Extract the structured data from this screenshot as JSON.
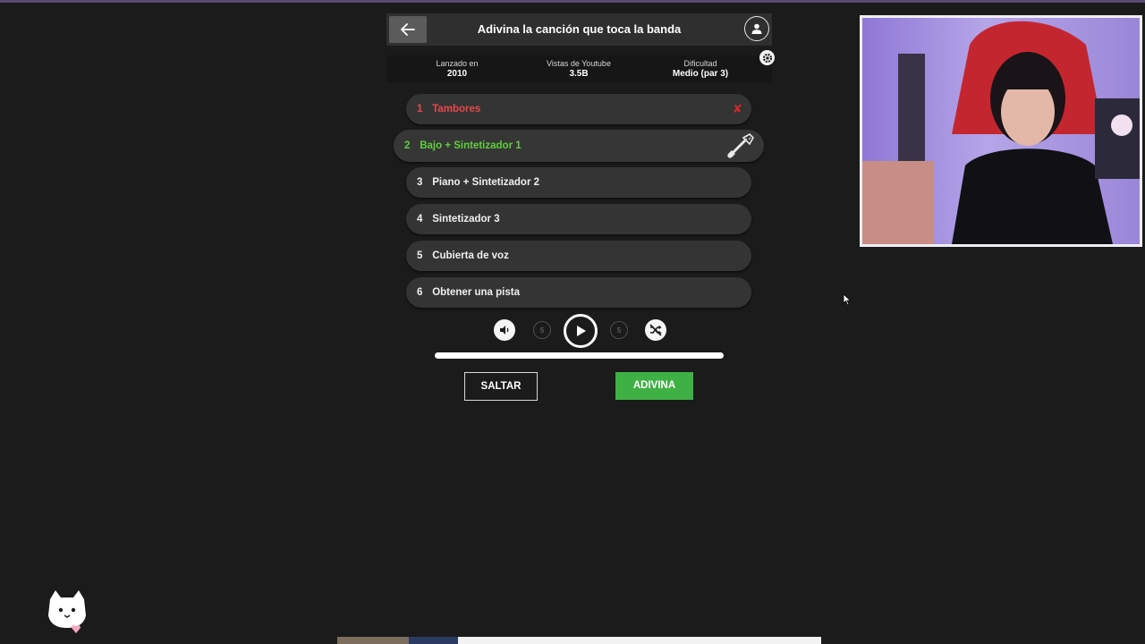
{
  "header": {
    "title": "Adivina la canción que toca la banda",
    "back_icon": "arrow-left-icon",
    "profile_icon": "user-icon"
  },
  "info": {
    "released_label": "Lanzado en",
    "released_value": "2010",
    "views_label": "Vistas de Youtube",
    "views_value": "3.5B",
    "difficulty_label": "Dificultad",
    "difficulty_value": "Medio (par 3)"
  },
  "tracks": [
    {
      "num": "1",
      "label": "Tambores",
      "state": "wrong"
    },
    {
      "num": "2",
      "label": "Bajo + Sintetizador 1",
      "state": "current"
    },
    {
      "num": "3",
      "label": "Piano + Sintetizador 2",
      "state": "locked"
    },
    {
      "num": "4",
      "label": "Sintetizador 3",
      "state": "locked"
    },
    {
      "num": "5",
      "label": "Cubierta de voz",
      "state": "locked"
    },
    {
      "num": "6",
      "label": "Obtener una pista",
      "state": "locked"
    }
  ],
  "controls": {
    "rewind_label": "5",
    "forward_label": "5",
    "progress": 1.0
  },
  "buttons": {
    "skip": "SALTAR",
    "guess": "ADIVINA"
  },
  "colors": {
    "accent_green": "#3eb044",
    "correct_text": "#5fcf3c",
    "wrong_text": "#e8474a",
    "background": "#1b1b1b"
  }
}
